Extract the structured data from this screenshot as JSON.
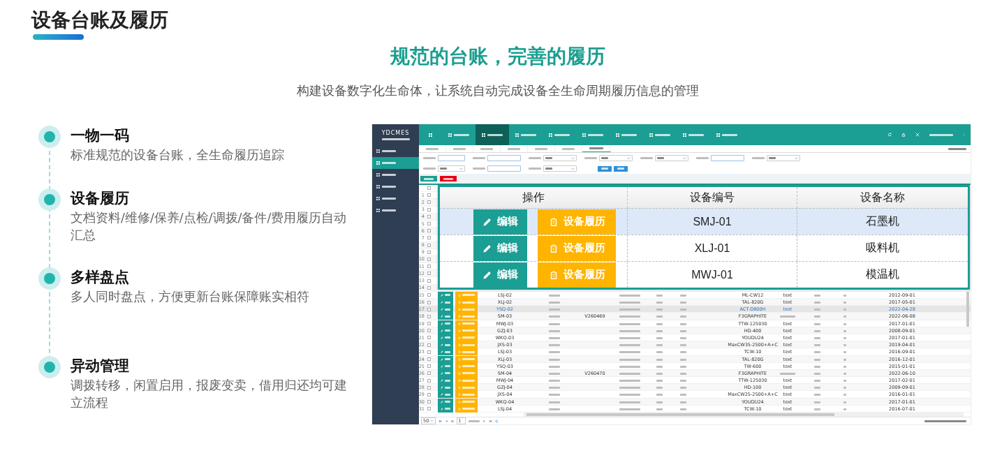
{
  "page_title": "设备台账及履历",
  "headline": "规范的台账，完善的履历",
  "subtitle": "构建设备数字化生命体，让系统自动完成设备全生命周期履历信息的管理",
  "features": [
    {
      "title": "一物一码",
      "text": "标准规范的设备台账，全生命履历追踪"
    },
    {
      "title": "设备履历",
      "text": "文档资料/维修/保养/点检/调拨/备件/费用履历自动汇总"
    },
    {
      "title": "多样盘点",
      "text": "多人同时盘点，方便更新台账保障账实相符"
    },
    {
      "title": "异动管理",
      "text": "调拨转移，闲置启用，报废变卖，借用归还均可建立流程"
    }
  ],
  "app": {
    "logo": "YDCMES",
    "nav": [
      {
        "selected": false
      },
      {
        "selected": true
      },
      {
        "selected": false
      },
      {
        "selected": false
      },
      {
        "selected": false
      },
      {
        "selected": false
      },
      {
        "selected": false
      },
      {
        "selected": false
      },
      {
        "selected": false
      }
    ],
    "sidebar": [
      {
        "selected": false
      },
      {
        "selected": true
      },
      {
        "selected": false
      },
      {
        "selected": false
      },
      {
        "selected": false
      },
      {
        "selected": false
      }
    ],
    "tabs": [
      {
        "selected": false
      },
      {
        "selected": false
      },
      {
        "selected": false
      },
      {
        "selected": false
      },
      {
        "selected": false
      },
      {
        "selected": false
      },
      {
        "selected": true
      }
    ],
    "filters": [
      [
        {
          "kind": "input"
        },
        {
          "kind": "input"
        },
        {
          "kind": "select"
        },
        {
          "kind": "select"
        },
        {
          "kind": "select"
        },
        {
          "kind": "input"
        },
        {
          "kind": "select"
        }
      ],
      [
        {
          "kind": "select"
        },
        {
          "kind": "input"
        },
        {
          "kind": "select"
        }
      ]
    ],
    "all_checked": false,
    "rows": [
      {
        "no": "1",
        "checked": false
      },
      {
        "no": "2",
        "checked": false
      },
      {
        "no": "3",
        "checked": false
      },
      {
        "no": "4",
        "checked": false
      },
      {
        "no": "5",
        "checked": false
      },
      {
        "no": "6",
        "checked": false
      },
      {
        "no": "7",
        "checked": false
      },
      {
        "no": "8",
        "checked": false
      },
      {
        "no": "9",
        "checked": false
      },
      {
        "no": "10",
        "checked": false
      },
      {
        "no": "11",
        "checked": false
      },
      {
        "no": "12",
        "checked": false
      },
      {
        "no": "13",
        "checked": false
      },
      {
        "no": "14",
        "checked": false
      },
      {
        "no": "15",
        "checked": false,
        "selected": false,
        "code": "LSJ-02",
        "model": "ML-CW12",
        "desc": "text",
        "date": "2012-09-01"
      },
      {
        "no": "16",
        "checked": false,
        "selected": false,
        "code": "XLJ-02",
        "model": "TAL-820G",
        "desc": "text",
        "date": "2017-05-01"
      },
      {
        "no": "17",
        "checked": false,
        "selected": true,
        "code": "YSQ-02",
        "model": "ACT-D800H",
        "desc": "text",
        "date": "2022-04-28"
      },
      {
        "no": "18",
        "checked": false,
        "selected": false,
        "code": "SM-03",
        "col_3": "V260469",
        "model": "F3GRAPHITE",
        "date": "2022-06-08"
      },
      {
        "no": "19",
        "checked": false,
        "selected": false,
        "code": "MWJ-03",
        "model": "TTW-125030",
        "desc": "text",
        "date": "2017-01-01"
      },
      {
        "no": "20",
        "checked": false,
        "selected": false,
        "code": "GZJ-03",
        "model": "HD-400",
        "desc": "text",
        "date": "2008-09-01"
      },
      {
        "no": "21",
        "checked": false,
        "selected": false,
        "code": "WKQ-03",
        "model": "YOUDU24",
        "desc": "text",
        "date": "2017-01-01"
      },
      {
        "no": "22",
        "checked": false,
        "selected": false,
        "code": "JXS-03",
        "model": "MaxCW35-2500+A+C",
        "desc": "text",
        "date": "2019-04-01"
      },
      {
        "no": "23",
        "checked": false,
        "selected": false,
        "code": "LSJ-03",
        "model": "TCW-10",
        "desc": "text",
        "date": "2016-09-01"
      },
      {
        "no": "24",
        "checked": false,
        "selected": false,
        "code": "XLJ-03",
        "model": "TAL-820G",
        "desc": "text",
        "date": "2016-12-01"
      },
      {
        "no": "25",
        "checked": false,
        "selected": false,
        "code": "YSQ-03",
        "model": "TW-600",
        "desc": "text",
        "date": "2015-01-01"
      },
      {
        "no": "26",
        "checked": false,
        "selected": false,
        "code": "SM-04",
        "col_3": "V260470",
        "model": "F3GRAPHITE",
        "date": "2022-06-10"
      },
      {
        "no": "27",
        "checked": false,
        "selected": false,
        "code": "MWJ-04",
        "model": "TTW-125030",
        "desc": "text",
        "date": "2017-02-01"
      },
      {
        "no": "28",
        "checked": false,
        "selected": false,
        "code": "GZJ-04",
        "model": "HD-100",
        "desc": "text",
        "date": "2009-09-01"
      },
      {
        "no": "29",
        "checked": false,
        "selected": false,
        "code": "JXS-04",
        "model": "MaxCW25-2500+A+C",
        "desc": "text",
        "date": "2016-01-01"
      },
      {
        "no": "30",
        "checked": false,
        "selected": false,
        "code": "WKQ-04",
        "model": "YOUDU24",
        "desc": "text",
        "date": "2017-01-01"
      },
      {
        "no": "31",
        "checked": false,
        "selected": false,
        "code": "LSJ-04",
        "model": "TCW-10",
        "desc": "text",
        "date": "2016-07-01"
      }
    ],
    "pager": {
      "page_size": "50",
      "page": "1"
    },
    "zoom": {
      "columns": [
        "操作",
        "设备编号",
        "设备名称"
      ],
      "rows": [
        {
          "selected": true,
          "edit": "编辑",
          "history": "设备履历",
          "code": "SMJ-01",
          "name": "石墨机"
        },
        {
          "selected": false,
          "edit": "编辑",
          "history": "设备履历",
          "code": "XLJ-01",
          "name": "吸料机"
        },
        {
          "selected": false,
          "edit": "编辑",
          "history": "设备履历",
          "code": "MWJ-01",
          "name": "模温机"
        }
      ]
    }
  }
}
